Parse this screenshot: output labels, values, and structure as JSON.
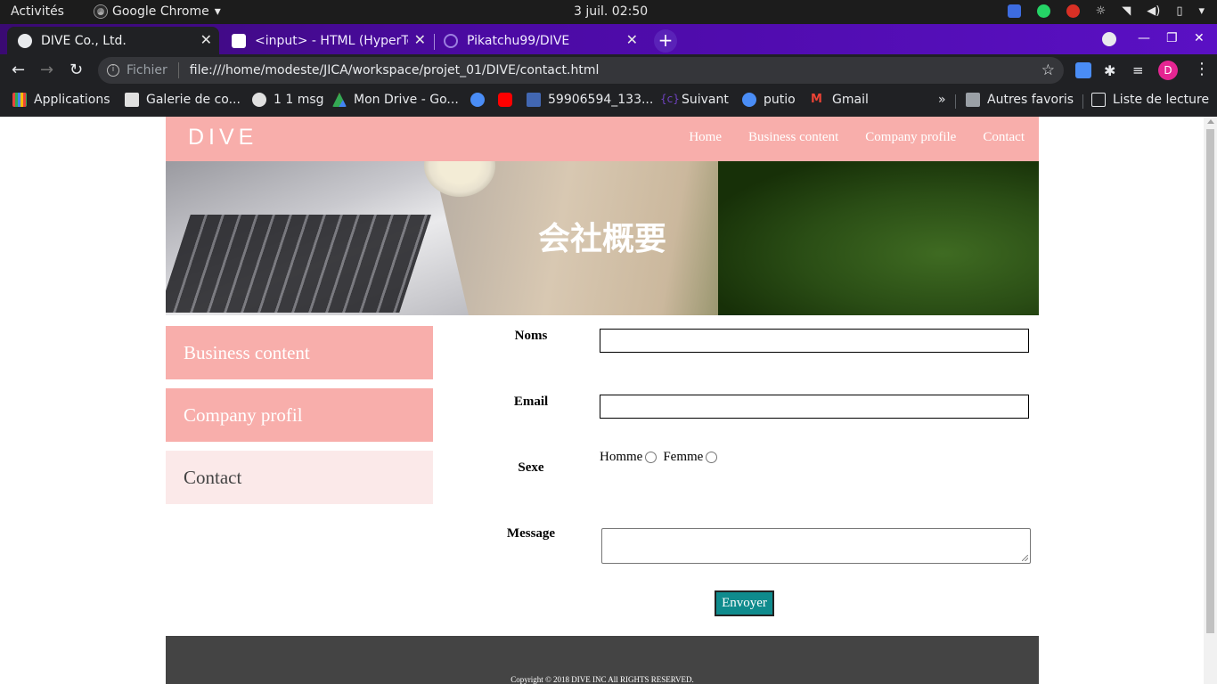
{
  "system": {
    "activities": "Activités",
    "app_name": "Google Chrome",
    "clock": "3 juil.  02:50"
  },
  "browser": {
    "tabs": [
      {
        "label": "DIVE Co., Ltd.",
        "active": true
      },
      {
        "label": "<input> - HTML (HyperTex",
        "active": false
      },
      {
        "label": "Pikatchu99/DIVE",
        "active": false
      }
    ],
    "address": {
      "scheme_label": "Fichier",
      "url": "file:///home/modeste/JICA/workspace/projet_01/DIVE/contact.html"
    },
    "profile_initial": "D",
    "bookmarks": [
      {
        "label": "Applications",
        "icon": "apps-grid-icon",
        "color": "#e8453c"
      },
      {
        "label": "Galerie de co...",
        "icon": "gallery-icon",
        "color": "#e0e0e0"
      },
      {
        "label": "1 1 msg",
        "icon": "globe-icon",
        "color": "#e0e0e0"
      },
      {
        "label": "Mon Drive - Go...",
        "icon": "google-drive-icon",
        "color": "#34a853"
      },
      {
        "label": "",
        "icon": "globe-blue-icon",
        "color": "#4a8df6"
      },
      {
        "label": "",
        "icon": "youtube-icon",
        "color": "#ff0000"
      },
      {
        "label": "59906594_133...",
        "icon": "facebook-icon",
        "color": "#4267b2"
      },
      {
        "label": "Suivant",
        "icon": "bracket-icon",
        "color": "#6f42c1"
      },
      {
        "label": "putio",
        "icon": "globe-icon",
        "color": "#4a8df6"
      },
      {
        "label": "Gmail",
        "icon": "gmail-icon",
        "color": "#ea4335"
      }
    ],
    "bookmarks_overflow": "»",
    "other_bookmarks": "Autres favoris",
    "reading_list": "Liste de lecture"
  },
  "site": {
    "logo": "DIVE",
    "nav": [
      "Home",
      "Business content",
      "Company profile",
      "Contact"
    ],
    "hero_title": "会社概要",
    "sidebar": [
      {
        "label": "Business content",
        "style": "pink"
      },
      {
        "label": "Company profil",
        "style": "pink"
      },
      {
        "label": "Contact",
        "style": "light"
      }
    ],
    "form": {
      "name_label": "Noms",
      "email_label": "Email",
      "sex_label": "Sexe",
      "male_label": "Homme",
      "female_label": "Femme",
      "message_label": "Message",
      "submit_label": "Envoyer"
    },
    "footer_copyright": "Copyright © 2018 DIVE INC All RIGHTS RESERVED.",
    "colors": {
      "header_pink": "#f8aeab",
      "sidebar_light": "#fbe9e9",
      "button_teal": "#0f8b8d",
      "footer_gray": "#444444"
    }
  }
}
